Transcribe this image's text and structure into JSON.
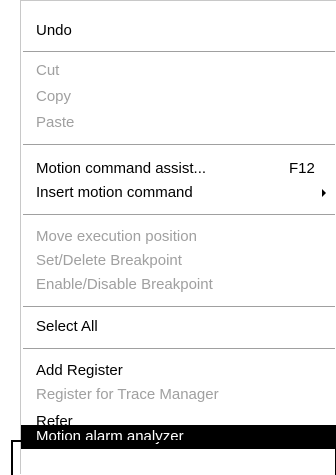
{
  "menu": {
    "items": [
      {
        "label": "Undo",
        "enabled": true
      },
      {
        "label": "Cut",
        "enabled": false
      },
      {
        "label": "Copy",
        "enabled": false
      },
      {
        "label": "Paste",
        "enabled": false
      },
      {
        "label": "Motion command assist...",
        "shortcut": "F12",
        "enabled": true
      },
      {
        "label": "Insert motion command",
        "enabled": true,
        "submenu": true
      },
      {
        "label": "Move execution position",
        "enabled": false
      },
      {
        "label": "Set/Delete Breakpoint",
        "enabled": false
      },
      {
        "label": "Enable/Disable Breakpoint",
        "enabled": false
      },
      {
        "label": "Select All",
        "enabled": true
      },
      {
        "label": "Add Register",
        "enabled": true
      },
      {
        "label": "Register for Trace Manager",
        "enabled": false
      },
      {
        "label": "Refer",
        "enabled": true
      },
      {
        "label": "Motion alarm analyzer",
        "enabled": true,
        "highlighted": true
      }
    ]
  },
  "icons": {
    "submenu_arrow": "triangle-right-icon"
  },
  "colors": {
    "enabled_text": "#000000",
    "disabled_text": "#a0a0a0",
    "highlight_bg": "#000000",
    "highlight_text": "#ffffff",
    "background": "#ffffff"
  }
}
